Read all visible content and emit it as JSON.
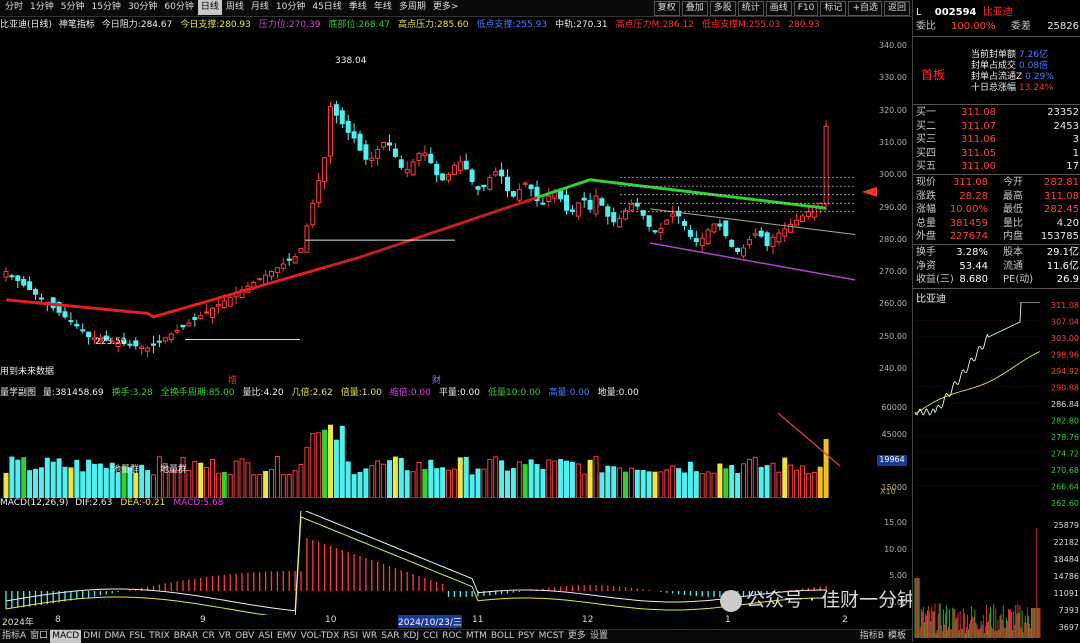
{
  "period_tabs": [
    "分时",
    "1分钟",
    "5分钟",
    "15分钟",
    "30分钟",
    "60分钟",
    "日线",
    "周线",
    "月线",
    "10分钟",
    "45日线",
    "季线",
    "年线",
    "多周期",
    "更多>"
  ],
  "active_period": "日线",
  "right_tabs": [
    "复权",
    "叠加",
    "多股",
    "统计",
    "画线",
    "F10",
    "标记",
    "+自选",
    "返回"
  ],
  "indicator_line": {
    "name": "比亚迪(日线)",
    "indicator": "神笔指标",
    "items": [
      {
        "label": "今日阻力:",
        "value": "284.67",
        "color": "white"
      },
      {
        "label": "今日支撑:",
        "value": "280.93",
        "color": "yellow"
      },
      {
        "label": "压力位:",
        "value": "270.39",
        "color": "magenta"
      },
      {
        "label": "底部位:",
        "value": "268.47",
        "color": "green"
      },
      {
        "label": "高点压力:",
        "value": "285.60",
        "color": "yellow"
      },
      {
        "label": "低点支撑:",
        "value": "255.93",
        "color": "blue"
      },
      {
        "label": "中轨:",
        "value": "270.31",
        "color": "white"
      },
      {
        "label": "高点压力M:",
        "value": "286.12",
        "color": "red"
      },
      {
        "label": "低点支撑M:",
        "value": "255.03",
        "color": "red"
      },
      {
        "label": "",
        "value": "280.93",
        "color": "red"
      }
    ]
  },
  "main_axis": [
    "340.00",
    "330.00",
    "320.00",
    "310.00",
    "300.00",
    "290.00",
    "280.00",
    "270.00",
    "260.00",
    "250.00",
    "240.00"
  ],
  "annotations": {
    "high": "338.04",
    "low": "223.50",
    "future": "用到未来数据",
    "zeng": "增",
    "cai": "财"
  },
  "volume_line": {
    "name": "量学副图",
    "items": [
      {
        "label": "量:",
        "value": "381458.69",
        "color": "white"
      },
      {
        "label": "换手:",
        "value": "3.28",
        "color": "green"
      },
      {
        "label": "全换手周期:",
        "value": "85.00",
        "color": "green"
      },
      {
        "label": "量比:",
        "value": "4.20",
        "color": "white"
      },
      {
        "label": "几倍:",
        "value": "2.62",
        "color": "yellow"
      },
      {
        "label": "倍量:",
        "value": "1.00",
        "color": "yellow"
      },
      {
        "label": "缩倍:",
        "value": "0.00",
        "color": "magenta"
      },
      {
        "label": "平量:",
        "value": "0.00",
        "color": "white"
      },
      {
        "label": "低量10:",
        "value": "0.00",
        "color": "green"
      },
      {
        "label": "高量:",
        "value": "0.00",
        "color": "blue"
      },
      {
        "label": "地量:",
        "value": "0.00",
        "color": "white"
      }
    ]
  },
  "volume_axis": [
    "60000",
    "45000",
    "30000",
    "15000"
  ],
  "volume_marker": "19964",
  "volume_x10": "X10",
  "volume_notes": [
    "地量群",
    "地量群"
  ],
  "macd_line": {
    "name": "MACD(12,26,9)",
    "items": [
      {
        "label": "DIF:",
        "value": "2.63",
        "color": "white"
      },
      {
        "label": "DEA:",
        "value": "-0.21",
        "color": "yellow"
      },
      {
        "label": "MACD:",
        "value": "5.68",
        "color": "magenta"
      }
    ]
  },
  "macd_axis": [
    "15.00",
    "10.00",
    "5.00",
    "0.00"
  ],
  "date_labels": [
    {
      "text": "2024年",
      "color": "white"
    },
    {
      "text": "8",
      "color": "white"
    },
    {
      "text": "9",
      "color": "white"
    },
    {
      "text": "10",
      "color": "white"
    },
    {
      "text": "2024/10/23/三",
      "color": "white"
    },
    {
      "text": "11",
      "color": "white"
    },
    {
      "text": "12",
      "color": "white"
    },
    {
      "text": "1",
      "color": "white"
    },
    {
      "text": "2",
      "color": "white"
    }
  ],
  "bottom_tabs": [
    "指标A",
    "窗口",
    "MACD",
    "DMI",
    "DMA",
    "FSL",
    "TRIX",
    "BRAR",
    "CR",
    "VR",
    "OBV",
    "ASI",
    "EMV",
    "VOL-TDX",
    "RSI",
    "WR",
    "SAR",
    "KDJ",
    "CCI",
    "ROC",
    "MTM",
    "BOLL",
    "PSY",
    "MCST",
    "更多",
    "设置"
  ],
  "bottom_right": [
    "指标B",
    "模板"
  ],
  "active_bottom": "MACD",
  "watermark": "公众号 · 佳财一分钟",
  "side": {
    "code": "002594",
    "name": "比亚迪",
    "rank": "L",
    "weibi_label": "委比",
    "weibi": "100.00%",
    "weicha_label": "委差",
    "weicha": "25826",
    "shouban": "首板",
    "seal": [
      {
        "k": "当前封单额",
        "v": "7.26亿"
      },
      {
        "k": "封单占成交",
        "v": "0.08倍"
      },
      {
        "k": "封单占流通Z",
        "v": "0.29%"
      },
      {
        "k": "十日总涨幅",
        "v": "13.24%"
      }
    ],
    "book": [
      {
        "k": "买一",
        "p": "311.08",
        "v": "23352"
      },
      {
        "k": "买二",
        "p": "311.07",
        "v": "2453"
      },
      {
        "k": "买三",
        "p": "311.06",
        "v": "3"
      },
      {
        "k": "买四",
        "p": "311.05",
        "v": "1"
      },
      {
        "k": "买五",
        "p": "311.00",
        "v": "17"
      }
    ],
    "quote": [
      {
        "a": "现价",
        "av": "311.08",
        "b": "今开",
        "bv": "282.81"
      },
      {
        "a": "涨跌",
        "av": "28.28",
        "b": "最高",
        "bv": "311.08"
      },
      {
        "a": "涨幅",
        "av": "10.00%",
        "b": "最低",
        "bv": "282.45"
      },
      {
        "a": "总量",
        "av": "381459",
        "b": "量比",
        "bv": "4.20"
      },
      {
        "a": "外盘",
        "av": "227674",
        "b": "内盘",
        "bv": "153785"
      }
    ],
    "stats": [
      {
        "a": "换手",
        "av": "3.28%",
        "b": "股本",
        "bv": "29.1亿"
      },
      {
        "a": "净资",
        "av": "53.44",
        "b": "流通",
        "bv": "11.6亿"
      },
      {
        "a": "收益(三)",
        "av": "8.680",
        "b": "PE(动)",
        "bv": "26.9"
      }
    ],
    "mini_title": "比亚迪",
    "mini_axis": [
      "311.08",
      "307.04",
      "303.00",
      "298.96",
      "294.92",
      "290.88",
      "286.84",
      "282.80",
      "278.76",
      "274.72",
      "270.68",
      "266.64",
      "262.60"
    ],
    "mini_vol_axis": [
      "25879",
      "22182",
      "18484",
      "14786",
      "11091",
      "7393",
      "3697"
    ]
  },
  "chart_data": {
    "type": "candlestick",
    "title": "比亚迪(日线)",
    "ylim": [
      220,
      345
    ],
    "x_months": [
      "2024-07",
      "8",
      "9",
      "10",
      "11",
      "12",
      "1",
      "2"
    ],
    "high_point": 338.04,
    "low_point": 223.5,
    "last_close": 311.08,
    "last_volume": 381458.69
  }
}
